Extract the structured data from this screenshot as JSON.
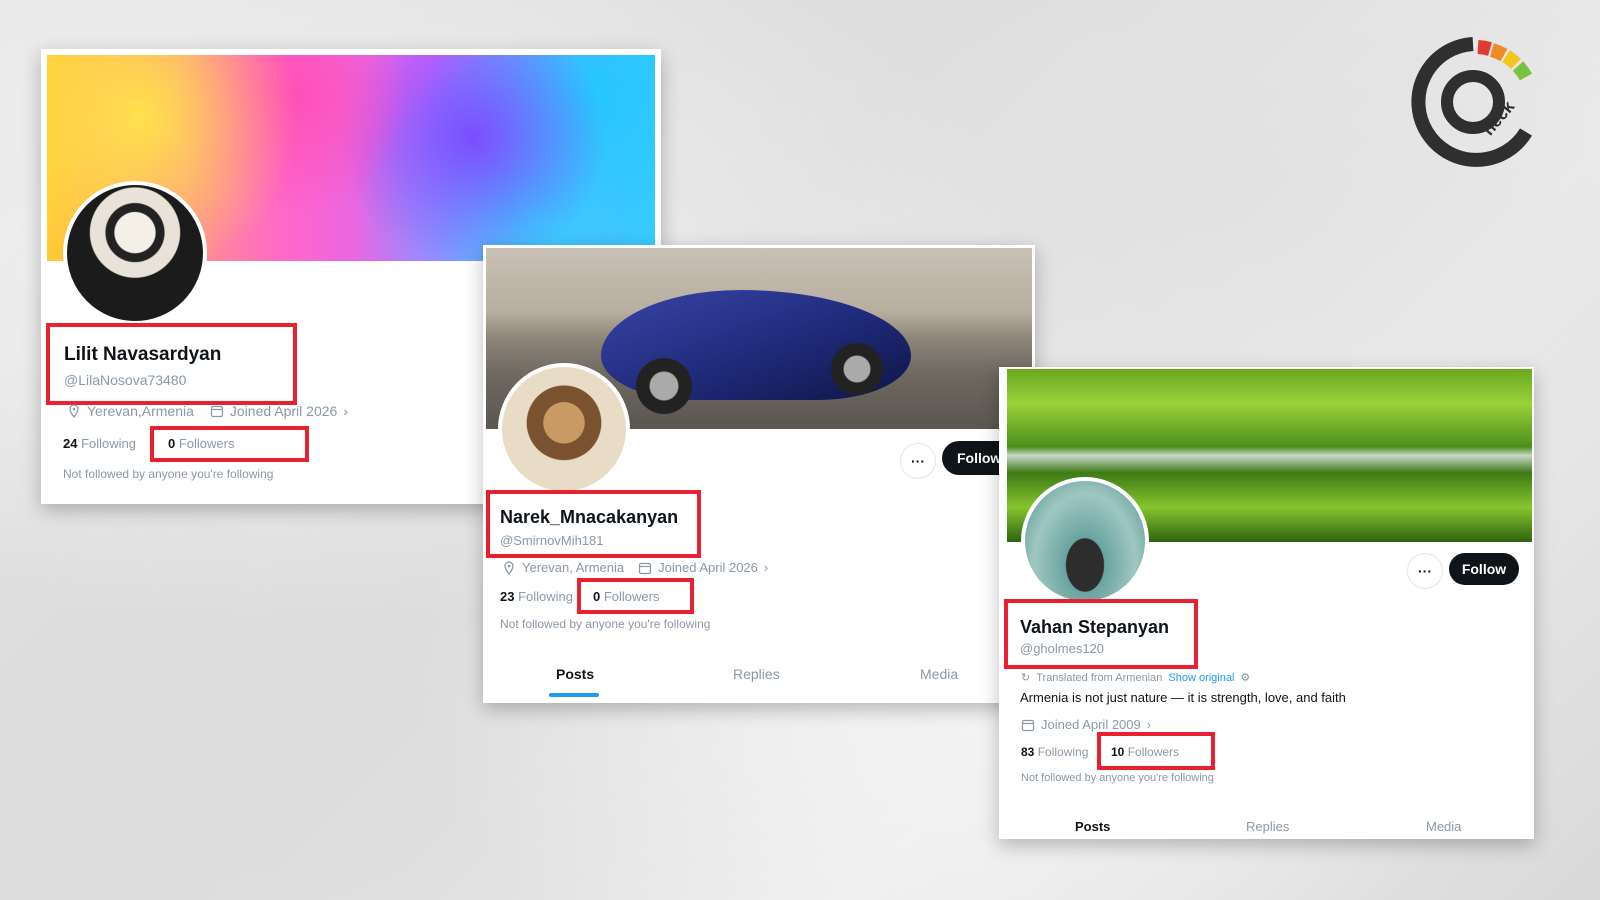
{
  "profiles": [
    {
      "name": "Lilit Navasardyan",
      "handle": "@LilaNosova73480",
      "location": "Yerevan,Armenia",
      "joined": "Joined April 2026",
      "following_count": "24",
      "following_label": "Following",
      "followers_count": "0",
      "followers_label": "Followers",
      "note": "Not followed by anyone you're following"
    },
    {
      "name": "Narek_Mnacakanyan",
      "handle": "@SmirnovMih181",
      "location": "Yerevan, Armenia",
      "joined": "Joined April 2026",
      "following_count": "23",
      "following_label": "Following",
      "followers_count": "0",
      "followers_label": "Followers",
      "note": "Not followed by anyone you're following",
      "follow_button": "Follow",
      "tabs": [
        "Posts",
        "Replies",
        "Media"
      ]
    },
    {
      "name": "Vahan Stepanyan",
      "handle": "@gholmes120",
      "translated": "Translated from Armenian",
      "show_original": "Show original",
      "bio": "Armenia is not just nature — it is strength, love, and faith",
      "joined": "Joined April 2009",
      "following_count": "83",
      "following_label": "Following",
      "followers_count": "10",
      "followers_label": "Followers",
      "note": "Not followed by anyone you're following",
      "follow_button": "Follow",
      "tabs": [
        "Posts",
        "Replies",
        "Media"
      ]
    }
  ],
  "logo": {
    "letters": "heck",
    "icon": "check-logo"
  },
  "colors": {
    "highlight": "#e8202f",
    "link": "#1d9bf0",
    "text": "#0f1419",
    "muted": "#8b98a5"
  }
}
